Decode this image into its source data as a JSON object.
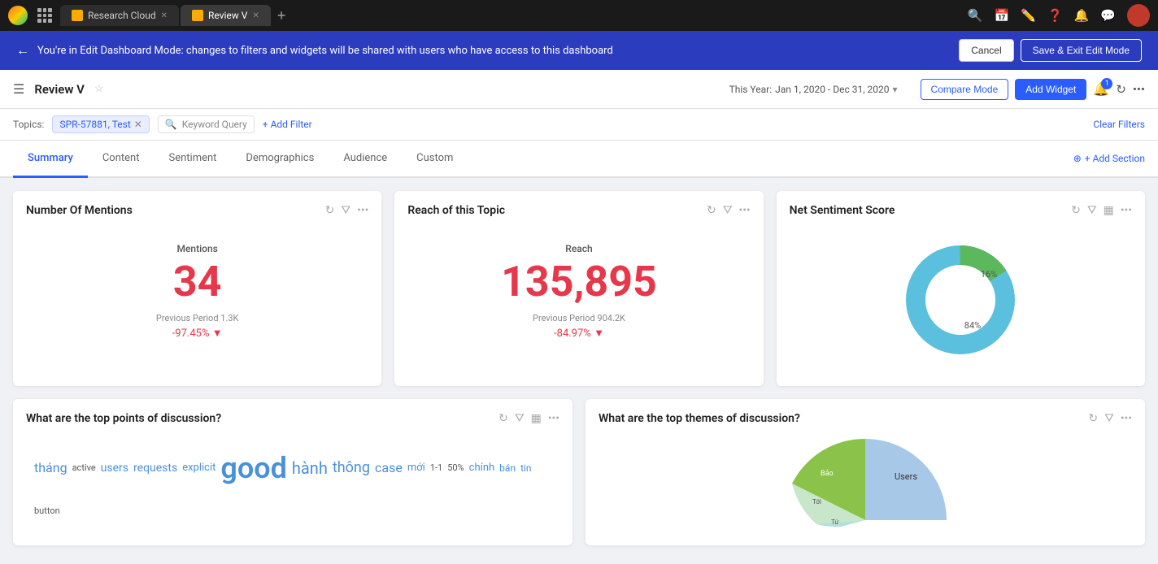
{
  "browser": {
    "app_name": "Research Cloud",
    "tab_label": "Review V",
    "new_tab_icon": "+"
  },
  "edit_banner": {
    "message": "You're in Edit Dashboard Mode: changes to filters and widgets will be shared with users who have access to this dashboard",
    "cancel_label": "Cancel",
    "save_label": "Save & Exit Edit Mode"
  },
  "toolbar": {
    "dashboard_title": "Review V",
    "date_label": "This Year:",
    "date_range": "Jan 1, 2020 - Dec 31, 2020",
    "compare_mode_label": "Compare Mode",
    "add_widget_label": "Add Widget",
    "notification_count": "1"
  },
  "filters": {
    "label": "Topics:",
    "tag": "SPR-57881, Test",
    "keyword_placeholder": "Keyword Query",
    "add_filter_label": "+ Add Filter",
    "clear_label": "Clear Filters"
  },
  "tabs": {
    "items": [
      {
        "id": "summary",
        "label": "Summary",
        "active": true
      },
      {
        "id": "content",
        "label": "Content",
        "active": false
      },
      {
        "id": "sentiment",
        "label": "Sentiment",
        "active": false
      },
      {
        "id": "demographics",
        "label": "Demographics",
        "active": false
      },
      {
        "id": "audience",
        "label": "Audience",
        "active": false
      },
      {
        "id": "custom",
        "label": "Custom",
        "active": false
      }
    ],
    "add_section_label": "+ Add Section"
  },
  "widgets": {
    "row1": [
      {
        "id": "mentions",
        "title": "Number Of Mentions",
        "metric_label": "Mentions",
        "metric_value": "34",
        "prev_label": "Previous Period 1.3K",
        "change": "-97.45%",
        "change_dir": "down"
      },
      {
        "id": "reach",
        "title": "Reach of this Topic",
        "metric_label": "Reach",
        "metric_value": "135,895",
        "prev_label": "Previous Period 904.2K",
        "change": "-84.97%",
        "change_dir": "down"
      },
      {
        "id": "sentiment",
        "title": "Net Sentiment Score",
        "donut": {
          "green_pct": 16,
          "blue_pct": 84,
          "green_label": "16%",
          "blue_label": "84%",
          "green_color": "#5cb85c",
          "blue_color": "#5bc0de"
        }
      }
    ],
    "row2": [
      {
        "id": "discussion_points",
        "title": "What are the top points of discussion?",
        "words": [
          {
            "text": "tháng",
            "size": 16,
            "color": "#4a90d9"
          },
          {
            "text": "active",
            "size": 12,
            "color": "#555"
          },
          {
            "text": "users",
            "size": 14,
            "color": "#4a90d9"
          },
          {
            "text": "requests",
            "size": 14,
            "color": "#4a90d9"
          },
          {
            "text": "explicit",
            "size": 13,
            "color": "#4a90d9"
          },
          {
            "text": "good",
            "size": 36,
            "color": "#4a90d9"
          },
          {
            "text": "hành",
            "size": 20,
            "color": "#4a90d9"
          },
          {
            "text": "thông",
            "size": 18,
            "color": "#4a90d9"
          },
          {
            "text": "case",
            "size": 16,
            "color": "#4a90d9"
          },
          {
            "text": "mới",
            "size": 14,
            "color": "#4a90d9"
          },
          {
            "text": "1-1",
            "size": 12,
            "color": "#555"
          },
          {
            "text": "50%",
            "size": 12,
            "color": "#555"
          },
          {
            "text": "chính",
            "size": 14,
            "color": "#4a90d9"
          },
          {
            "text": "bán",
            "size": 13,
            "color": "#4a90d9"
          },
          {
            "text": "tin",
            "size": 12,
            "color": "#4a90d9"
          },
          {
            "text": "button",
            "size": 11,
            "color": "#555"
          }
        ]
      },
      {
        "id": "discussion_themes",
        "title": "What are the top themes of discussion?",
        "pie_legend": [
          "Users",
          "Bảo",
          "Tới",
          "Tứ"
        ]
      }
    ]
  }
}
